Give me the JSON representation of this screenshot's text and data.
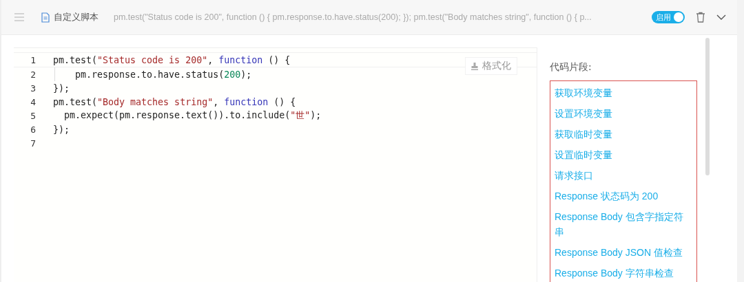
{
  "header": {
    "title": "自定义脚本",
    "summary": "pm.test(\"Status code is 200\", function () { pm.response.to.have.status(200); }); pm.test(\"Body matches string\", function () { p...",
    "toggle": {
      "label": "启用",
      "on": true
    }
  },
  "editor": {
    "format_button": "格式化",
    "lines": [
      {
        "number": "1",
        "tokens": [
          {
            "kind": "plain",
            "text": "pm.test("
          },
          {
            "kind": "string",
            "text": "\"Status code is 200\""
          },
          {
            "kind": "plain",
            "text": ", "
          },
          {
            "kind": "keyword",
            "text": "function"
          },
          {
            "kind": "plain",
            "text": " () {"
          }
        ]
      },
      {
        "number": "2",
        "guide": true,
        "tokens": [
          {
            "kind": "plain",
            "text": "    pm.response.to.have.status("
          },
          {
            "kind": "number",
            "text": "200"
          },
          {
            "kind": "plain",
            "text": ");"
          }
        ]
      },
      {
        "number": "3",
        "tokens": [
          {
            "kind": "plain",
            "text": "});"
          }
        ]
      },
      {
        "number": "4",
        "tokens": [
          {
            "kind": "plain",
            "text": "pm.test("
          },
          {
            "kind": "string",
            "text": "\"Body matches string\""
          },
          {
            "kind": "plain",
            "text": ", "
          },
          {
            "kind": "keyword",
            "text": "function"
          },
          {
            "kind": "plain",
            "text": " () {"
          }
        ]
      },
      {
        "number": "5",
        "tokens": [
          {
            "kind": "plain",
            "text": "  pm.expect(pm.response.text()).to.include("
          },
          {
            "kind": "string",
            "text": "\"世\""
          },
          {
            "kind": "plain",
            "text": ");"
          }
        ]
      },
      {
        "number": "6",
        "tokens": [
          {
            "kind": "plain",
            "text": "});"
          }
        ]
      },
      {
        "number": "7"
      }
    ]
  },
  "snippets": {
    "title": "代码片段:",
    "items": [
      "获取环境变量",
      "设置环境变量",
      "获取临时变量",
      "设置临时变量",
      "请求接口",
      "Response 状态码为 200",
      "Response Body 包含字指定符串",
      "Response Body JSON 值检查",
      "Response Body 字符串检查"
    ]
  }
}
